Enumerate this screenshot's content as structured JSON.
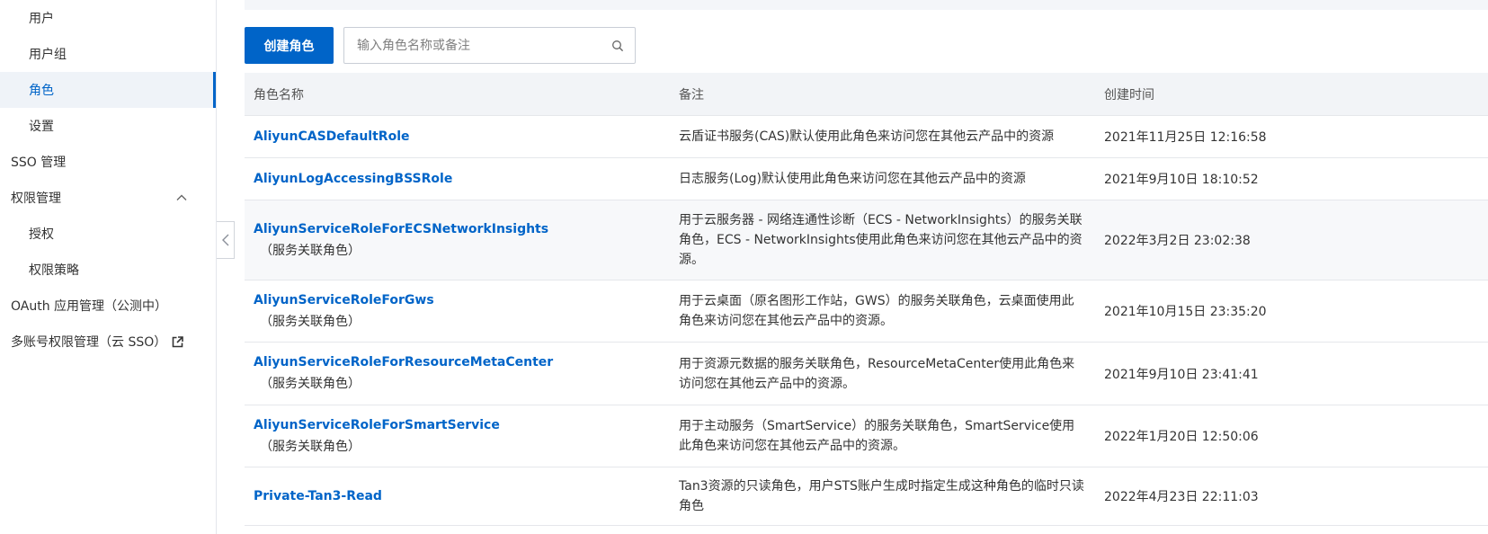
{
  "sidebar": {
    "items": [
      {
        "label": "用户"
      },
      {
        "label": "用户组"
      },
      {
        "label": "角色"
      },
      {
        "label": "设置"
      },
      {
        "label": "SSO 管理"
      },
      {
        "label": "权限管理"
      },
      {
        "label": "授权"
      },
      {
        "label": "权限策略"
      },
      {
        "label": "OAuth 应用管理（公测中）"
      },
      {
        "label": "多账号权限管理（云 SSO）"
      }
    ],
    "active": "角色"
  },
  "toolbar": {
    "create_label": "创建角色",
    "search_placeholder": "输入角色名称或备注",
    "search_value": ""
  },
  "table": {
    "headers": {
      "name": "角色名称",
      "note": "备注",
      "created": "创建时间"
    },
    "rows": [
      {
        "name": "AliyunCASDefaultRole",
        "sub": "",
        "note": "云盾证书服务(CAS)默认使用此角色来访问您在其他云产品中的资源",
        "created": "2021年11月25日 12:16:58"
      },
      {
        "name": "AliyunLogAccessingBSSRole",
        "sub": "",
        "note": "日志服务(Log)默认使用此角色来访问您在其他云产品中的资源",
        "created": "2021年9月10日 18:10:52"
      },
      {
        "name": "AliyunServiceRoleForECSNetworkInsights",
        "sub": "（服务关联角色）",
        "note": "用于云服务器 - 网络连通性诊断（ECS - NetworkInsights）的服务关联角色，ECS - NetworkInsights使用此角色来访问您在其他云产品中的资源。",
        "created": "2022年3月2日 23:02:38"
      },
      {
        "name": "AliyunServiceRoleForGws",
        "sub": "（服务关联角色）",
        "note": "用于云桌面（原名图形工作站，GWS）的服务关联角色，云桌面使用此角色来访问您在其他云产品中的资源。",
        "created": "2021年10月15日 23:35:20"
      },
      {
        "name": "AliyunServiceRoleForResourceMetaCenter",
        "sub": "（服务关联角色）",
        "note": "用于资源元数据的服务关联角色，ResourceMetaCenter使用此角色来访问您在其他云产品中的资源。",
        "created": "2021年9月10日 23:41:41"
      },
      {
        "name": "AliyunServiceRoleForSmartService",
        "sub": "（服务关联角色）",
        "note": "用于主动服务（SmartService）的服务关联角色，SmartService使用此角色来访问您在其他云产品中的资源。",
        "created": "2022年1月20日 12:50:06"
      },
      {
        "name": "Private-Tan3-Read",
        "sub": "",
        "note": "Tan3资源的只读角色，用户STS账户生成时指定生成这种角色的临时只读角色",
        "created": "2022年4月23日 22:11:03"
      }
    ]
  },
  "colors": {
    "accent": "#0064c8",
    "header_bg": "#f2f4f7",
    "active_bg": "#eff3f8"
  },
  "icons": {
    "chevron": "chevron-up-icon",
    "external": "external-link-icon",
    "search": "search-icon",
    "collapse": "chevron-left-icon"
  }
}
